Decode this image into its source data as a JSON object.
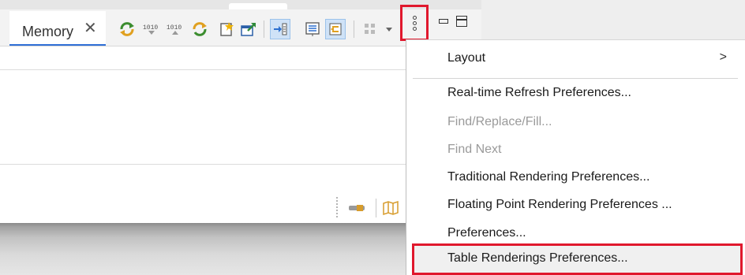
{
  "tab": {
    "title": "Memory",
    "close_glyph": "✕"
  },
  "toolbar": {
    "icons": [
      "new-rendering-icon",
      "binary-format-icon",
      "binary-format-2-icon",
      "refresh-icon",
      "new-page-icon",
      "export-icon",
      "link-scroll-icon",
      "table-view-icon",
      "switch-icon",
      "layout-icon",
      "dropdown-arrow-icon"
    ],
    "binary_text": "1010"
  },
  "window": {
    "minimize": "minimize-icon",
    "maximize": "maximize-icon"
  },
  "view_menu_button": "kebab-menu-icon",
  "menu": {
    "layout": "Layout",
    "layout_arrow": ">",
    "items": [
      {
        "label": "Real-time Refresh Preferences...",
        "enabled": true
      },
      {
        "label": "Find/Replace/Fill...",
        "enabled": false
      },
      {
        "label": "Find Next",
        "enabled": false
      },
      {
        "label": "Traditional Rendering Preferences...",
        "enabled": true
      },
      {
        "label": "Floating Point Rendering Preferences ...",
        "enabled": true
      },
      {
        "label": "Preferences...",
        "enabled": true
      },
      {
        "label": "Table Renderings Preferences...",
        "enabled": true,
        "highlighted": true
      }
    ]
  },
  "colors": {
    "accent": "#2f6fd6",
    "highlight_border": "#e0182d"
  }
}
